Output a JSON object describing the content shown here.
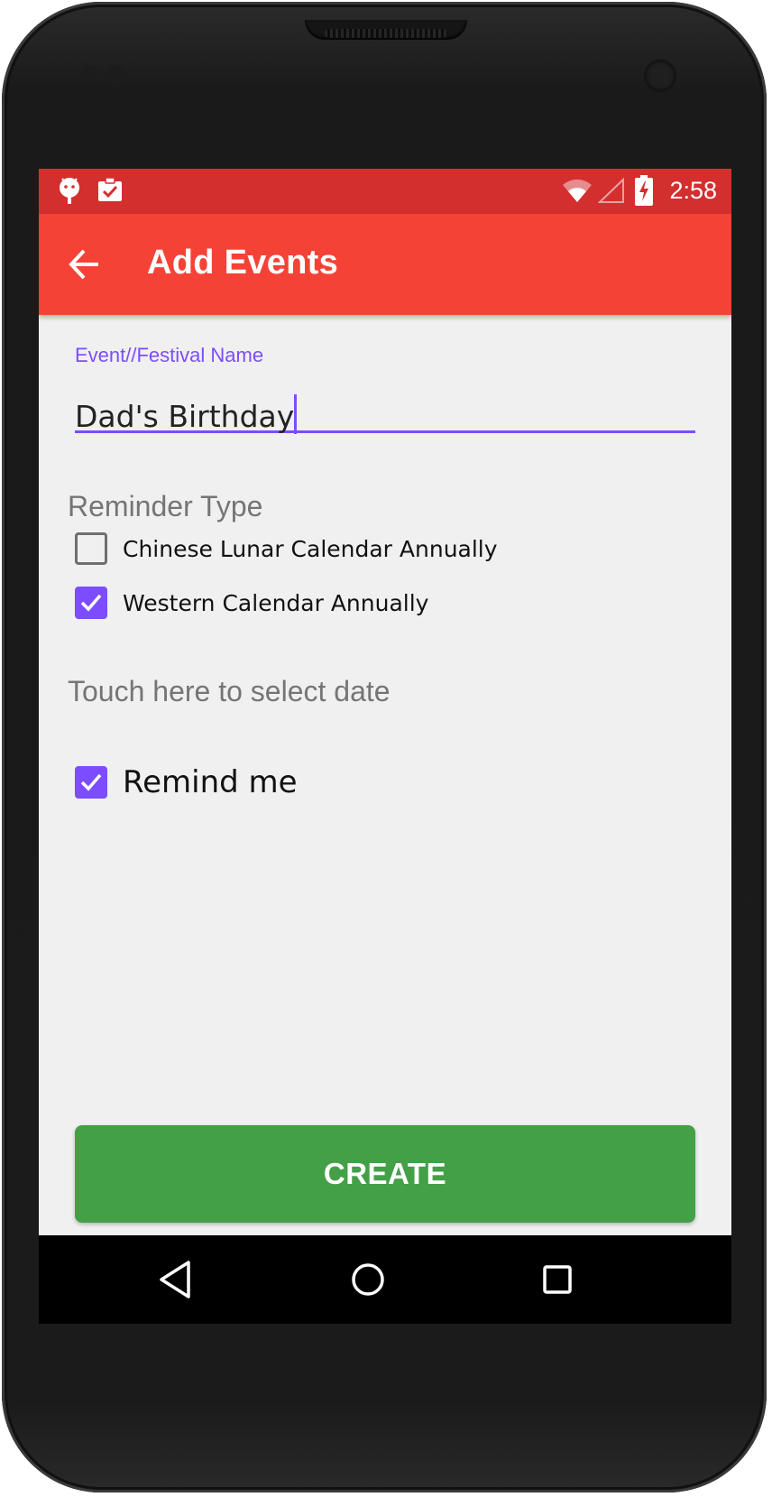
{
  "status_bar": {
    "time": "2:58",
    "left_icons": [
      "android-icon",
      "clipboard-check-icon"
    ],
    "right_icons": [
      "wifi-icon",
      "signal-icon",
      "battery-charging-icon"
    ]
  },
  "app_bar": {
    "back_icon": "arrow-left-icon",
    "title": "Add Events"
  },
  "form": {
    "name_field": {
      "label": "Event//Festival Name",
      "value": "Dad's Birthday"
    },
    "reminder_type": {
      "label": "Reminder Type",
      "options": [
        {
          "label": "Chinese Lunar Calendar Annually",
          "checked": false
        },
        {
          "label": "Western Calendar Annually",
          "checked": true
        }
      ]
    },
    "date_prompt": "Touch here to select date",
    "remind_me": {
      "label": "Remind me",
      "checked": true
    },
    "create_label": "CREATE"
  },
  "nav_bar": {
    "icons": [
      "back-triangle-icon",
      "home-circle-icon",
      "recents-square-icon"
    ]
  },
  "colors": {
    "status_bar": "#d32f2f",
    "app_bar": "#f44336",
    "accent": "#7c4dff",
    "create_button": "#43a047",
    "background": "#f0f0f0"
  }
}
